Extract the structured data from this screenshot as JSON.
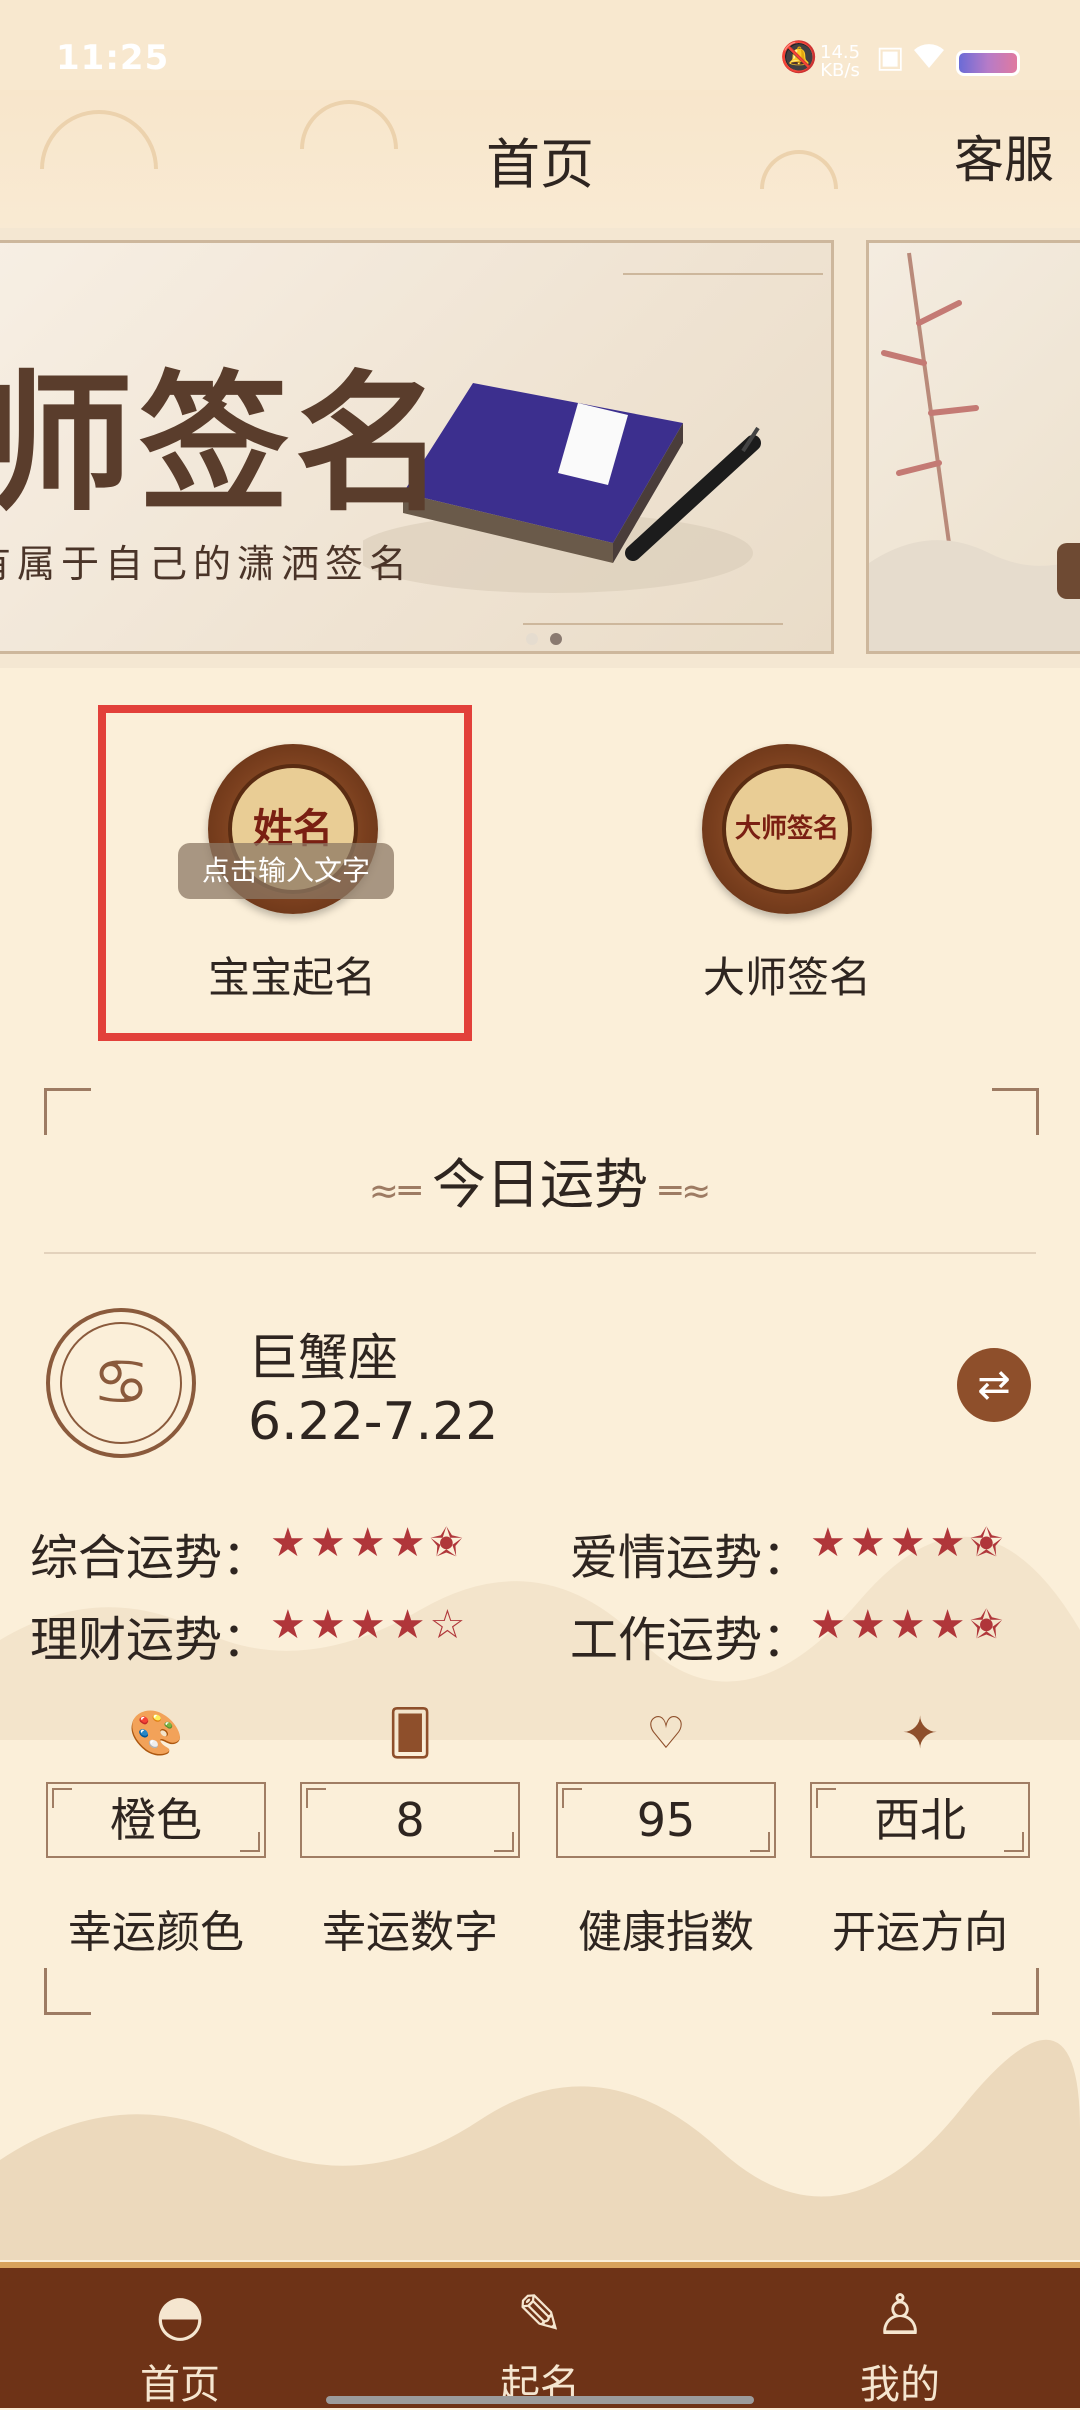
{
  "status_bar": {
    "time": "11:25",
    "network_speed": "14.5",
    "network_unit": "KB/s"
  },
  "header": {
    "title": "首页",
    "service": "客服"
  },
  "banner": {
    "title": "师签名",
    "subtitle": "有属于自己的潇洒签名",
    "active_index": 1,
    "page_count": 2
  },
  "features": [
    {
      "label": "宝宝起名",
      "icon_text": "姓名",
      "icon": "name-scroll-icon"
    },
    {
      "label": "大师签名",
      "icon_text": "大师签名",
      "icon": "master-fan-icon"
    }
  ],
  "tooltip": "点击输入文字",
  "fortune": {
    "section_title": "今日运势",
    "zodiac": {
      "name": "巨蟹座",
      "date_range": "6.22-7.22",
      "icon": "crab-icon"
    },
    "ratings": [
      {
        "label": "综合运势：",
        "stars": "★★★★✬",
        "value": 4.5
      },
      {
        "label": "爱情运势：",
        "stars": "★★★★✬",
        "value": 4.5
      },
      {
        "label": "理财运势：",
        "stars": "★★★★☆",
        "value": 4
      },
      {
        "label": "工作运势：",
        "stars": "★★★★✬",
        "value": 4.5
      }
    ],
    "stats": [
      {
        "value": "橙色",
        "label": "幸运颜色",
        "icon": "palette-icon"
      },
      {
        "value": "8",
        "label": "幸运数字",
        "icon": "card-star-icon"
      },
      {
        "value": "95",
        "label": "健康指数",
        "icon": "heartbeat-icon"
      },
      {
        "value": "西北",
        "label": "开运方向",
        "icon": "compass-icon"
      }
    ]
  },
  "tabbar": [
    {
      "label": "首页",
      "icon": "fan-icon",
      "active": true
    },
    {
      "label": "起名",
      "icon": "brush-icon",
      "active": false
    },
    {
      "label": "我的",
      "icon": "pagoda-icon",
      "active": false
    }
  ],
  "colors": {
    "background": "#fbefd9",
    "tabbar": "#6e3317",
    "accent": "#8e4f2b",
    "star": "#b0363a",
    "highlight": "#e2403a"
  }
}
